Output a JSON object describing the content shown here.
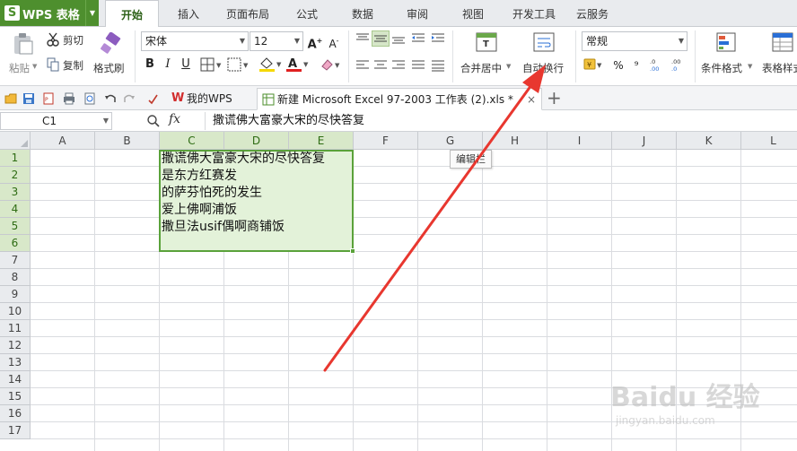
{
  "app": {
    "title": "WPS 表格"
  },
  "menu": {
    "tabs": [
      {
        "label": "开始"
      },
      {
        "label": "插入"
      },
      {
        "label": "页面布局"
      },
      {
        "label": "公式"
      },
      {
        "label": "数据"
      },
      {
        "label": "审阅"
      },
      {
        "label": "视图"
      },
      {
        "label": "开发工具"
      },
      {
        "label": "云服务"
      }
    ],
    "active_index": 0
  },
  "ribbon": {
    "paste_label": "粘贴",
    "cut_label": "剪切",
    "copy_label": "复制",
    "format_painter_label": "格式刷",
    "font_name": "宋体",
    "font_size": "12",
    "bold": "B",
    "italic": "I",
    "underline": "U",
    "merge_center_label": "合并居中",
    "wrap_text_label": "自动换行",
    "number_format": "常规",
    "percent": "%",
    "thousands": "⁹",
    "conditional_format_label": "条件格式",
    "table_style_label": "表格样式"
  },
  "doc_tabs": [
    {
      "label": "我的WPS"
    },
    {
      "label": "新建 Microsoft Excel 97-2003 工作表 (2).xls *"
    }
  ],
  "formula_bar": {
    "cell_ref": "C1",
    "fx": "fx",
    "content": "撒谎佛大富豪大宋的尽快答复"
  },
  "sheet": {
    "columns": [
      "A",
      "B",
      "C",
      "D",
      "E",
      "F",
      "G",
      "H",
      "I",
      "J",
      "K",
      "L"
    ],
    "rows": [
      "1",
      "2",
      "3",
      "4",
      "5",
      "6",
      "7",
      "8",
      "9",
      "10",
      "11",
      "12",
      "13",
      "14",
      "15",
      "16",
      "17"
    ],
    "cell_lines": [
      "撒谎佛大富豪大宋的尽快答复",
      "是东方红赛发",
      "的萨芬怕死的发生",
      "爱上佛啊浦饭",
      "撒旦法usif偶啊商铺饭"
    ]
  },
  "tooltip": "编辑栏",
  "watermark": {
    "brand": "Baidu 经验",
    "url": "jingyan.baidu.com"
  },
  "colors": {
    "accent": "#4e8f2e",
    "selection_fill": "#e3f2d9",
    "selection_border": "#5aa23a",
    "arrow": "#e8372f"
  }
}
